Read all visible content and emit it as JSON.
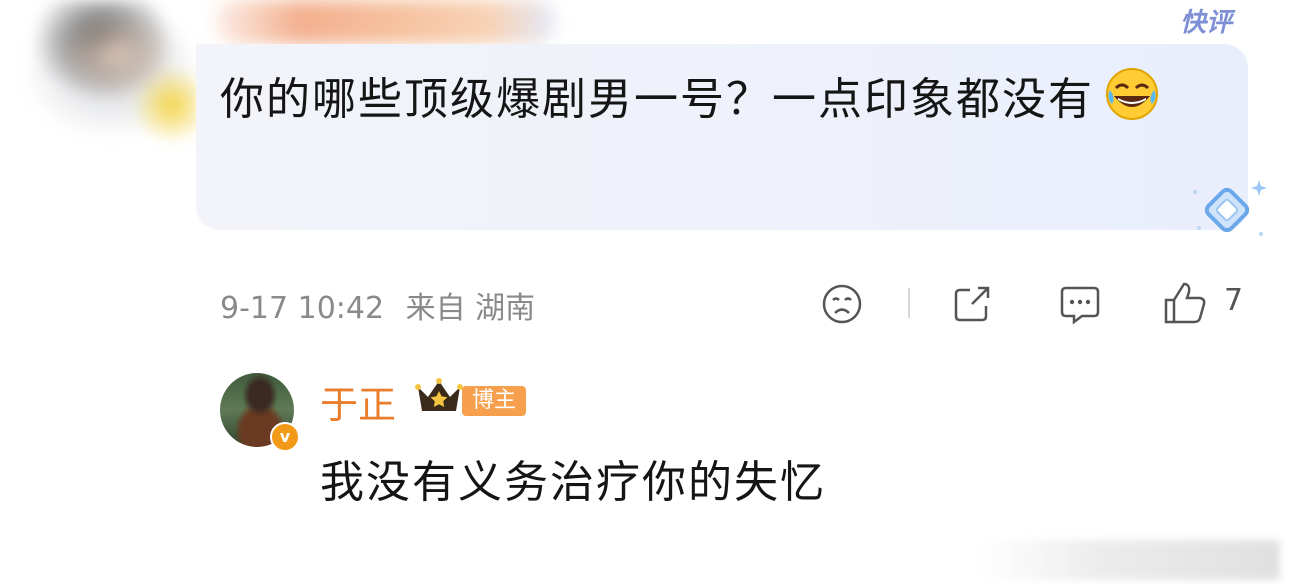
{
  "comment": {
    "badge_label": "快评",
    "text": "你的哪些顶级爆剧男一号？一点印象都没有",
    "emoji": "laughing-tears-emoji",
    "date": "9-17 10:42",
    "source": "来自 湖南",
    "like_count": "7"
  },
  "reply": {
    "author": "于正",
    "author_badge": "博主",
    "verified_mark": "v",
    "text": "我没有义务治疗你的失忆"
  },
  "colors": {
    "author_name": "#e87d2e",
    "badge_bg": "#f6a04d",
    "bubble_bg": "#eef1fb",
    "meta_text": "#8a8a8a"
  }
}
